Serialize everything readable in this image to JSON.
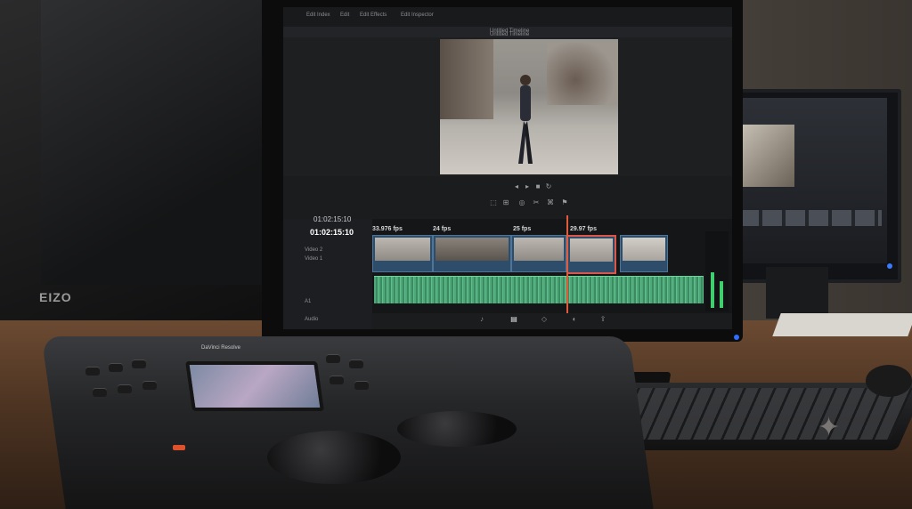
{
  "left_monitor": {
    "logo": "EIZO"
  },
  "editor": {
    "tabs": [
      "Edit Index",
      "Edit",
      "Edit Effects",
      "Edit Inspector"
    ],
    "viewer": {
      "title": "Untitled Timeline",
      "subtitle": "Untitled Timeline"
    },
    "timecode": {
      "current": "01:02:15:10",
      "playhead": "01:02:15:10"
    },
    "tracks": {
      "video": [
        {
          "id": "V2",
          "label": "Video 2"
        },
        {
          "id": "V1",
          "label": "Video 1"
        }
      ],
      "audio": [
        {
          "id": "A1",
          "label": "A1"
        },
        {
          "id": "A2",
          "label": "Audio"
        }
      ]
    },
    "clips": [
      {
        "fps": "33.976 fps",
        "selected": false
      },
      {
        "fps": "24 fps",
        "selected": false
      },
      {
        "fps": "25 fps",
        "selected": false
      },
      {
        "fps": "29.97 fps",
        "selected": true
      },
      {
        "fps": "",
        "selected": false
      }
    ],
    "pages": [
      "Media",
      "Edit",
      "Fusion",
      "Color",
      "Deliver"
    ],
    "active_page": "Edit",
    "colors": {
      "playhead": "#e05a3c",
      "audio_wave": "#4ea87a",
      "clip": "#2d4d6a",
      "selected_clip": "#d8574a"
    }
  },
  "control_panel": {
    "brand": "DaVinci Resolve"
  }
}
